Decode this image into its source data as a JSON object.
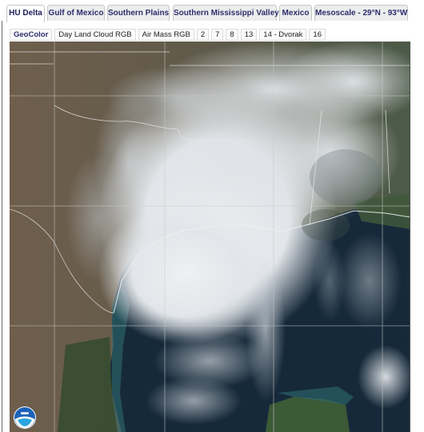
{
  "tabs": [
    {
      "label": "HU Delta",
      "active": true
    },
    {
      "label": "Gulf of Mexico",
      "active": false
    },
    {
      "label": "Southern Plains",
      "active": false
    },
    {
      "label": "Southern Mississippi Valley",
      "active": false
    },
    {
      "label": "Mexico",
      "active": false
    },
    {
      "label": "Mesoscale - 29°N - 93°W",
      "active": false
    }
  ],
  "bands": [
    {
      "label": "GeoColor",
      "active": true
    },
    {
      "label": "Day Land Cloud RGB",
      "active": false
    },
    {
      "label": "Air Mass RGB",
      "active": false
    },
    {
      "label": "2",
      "active": false
    },
    {
      "label": "7",
      "active": false
    },
    {
      "label": "8",
      "active": false
    },
    {
      "label": "13",
      "active": false
    },
    {
      "label": "14 - Dvorak",
      "active": false
    },
    {
      "label": "16",
      "active": false
    }
  ],
  "image": {
    "description": "GeoColor satellite image of Hurricane Delta over the Gulf of Mexico and southern US",
    "logo": "noaa-logo-icon"
  },
  "colors": {
    "tab_text": "#2e2e6e",
    "tab_bg": "#ededed",
    "land": "#6e6250",
    "ocean": "#14283a",
    "cloud": "#e6e9ec"
  }
}
